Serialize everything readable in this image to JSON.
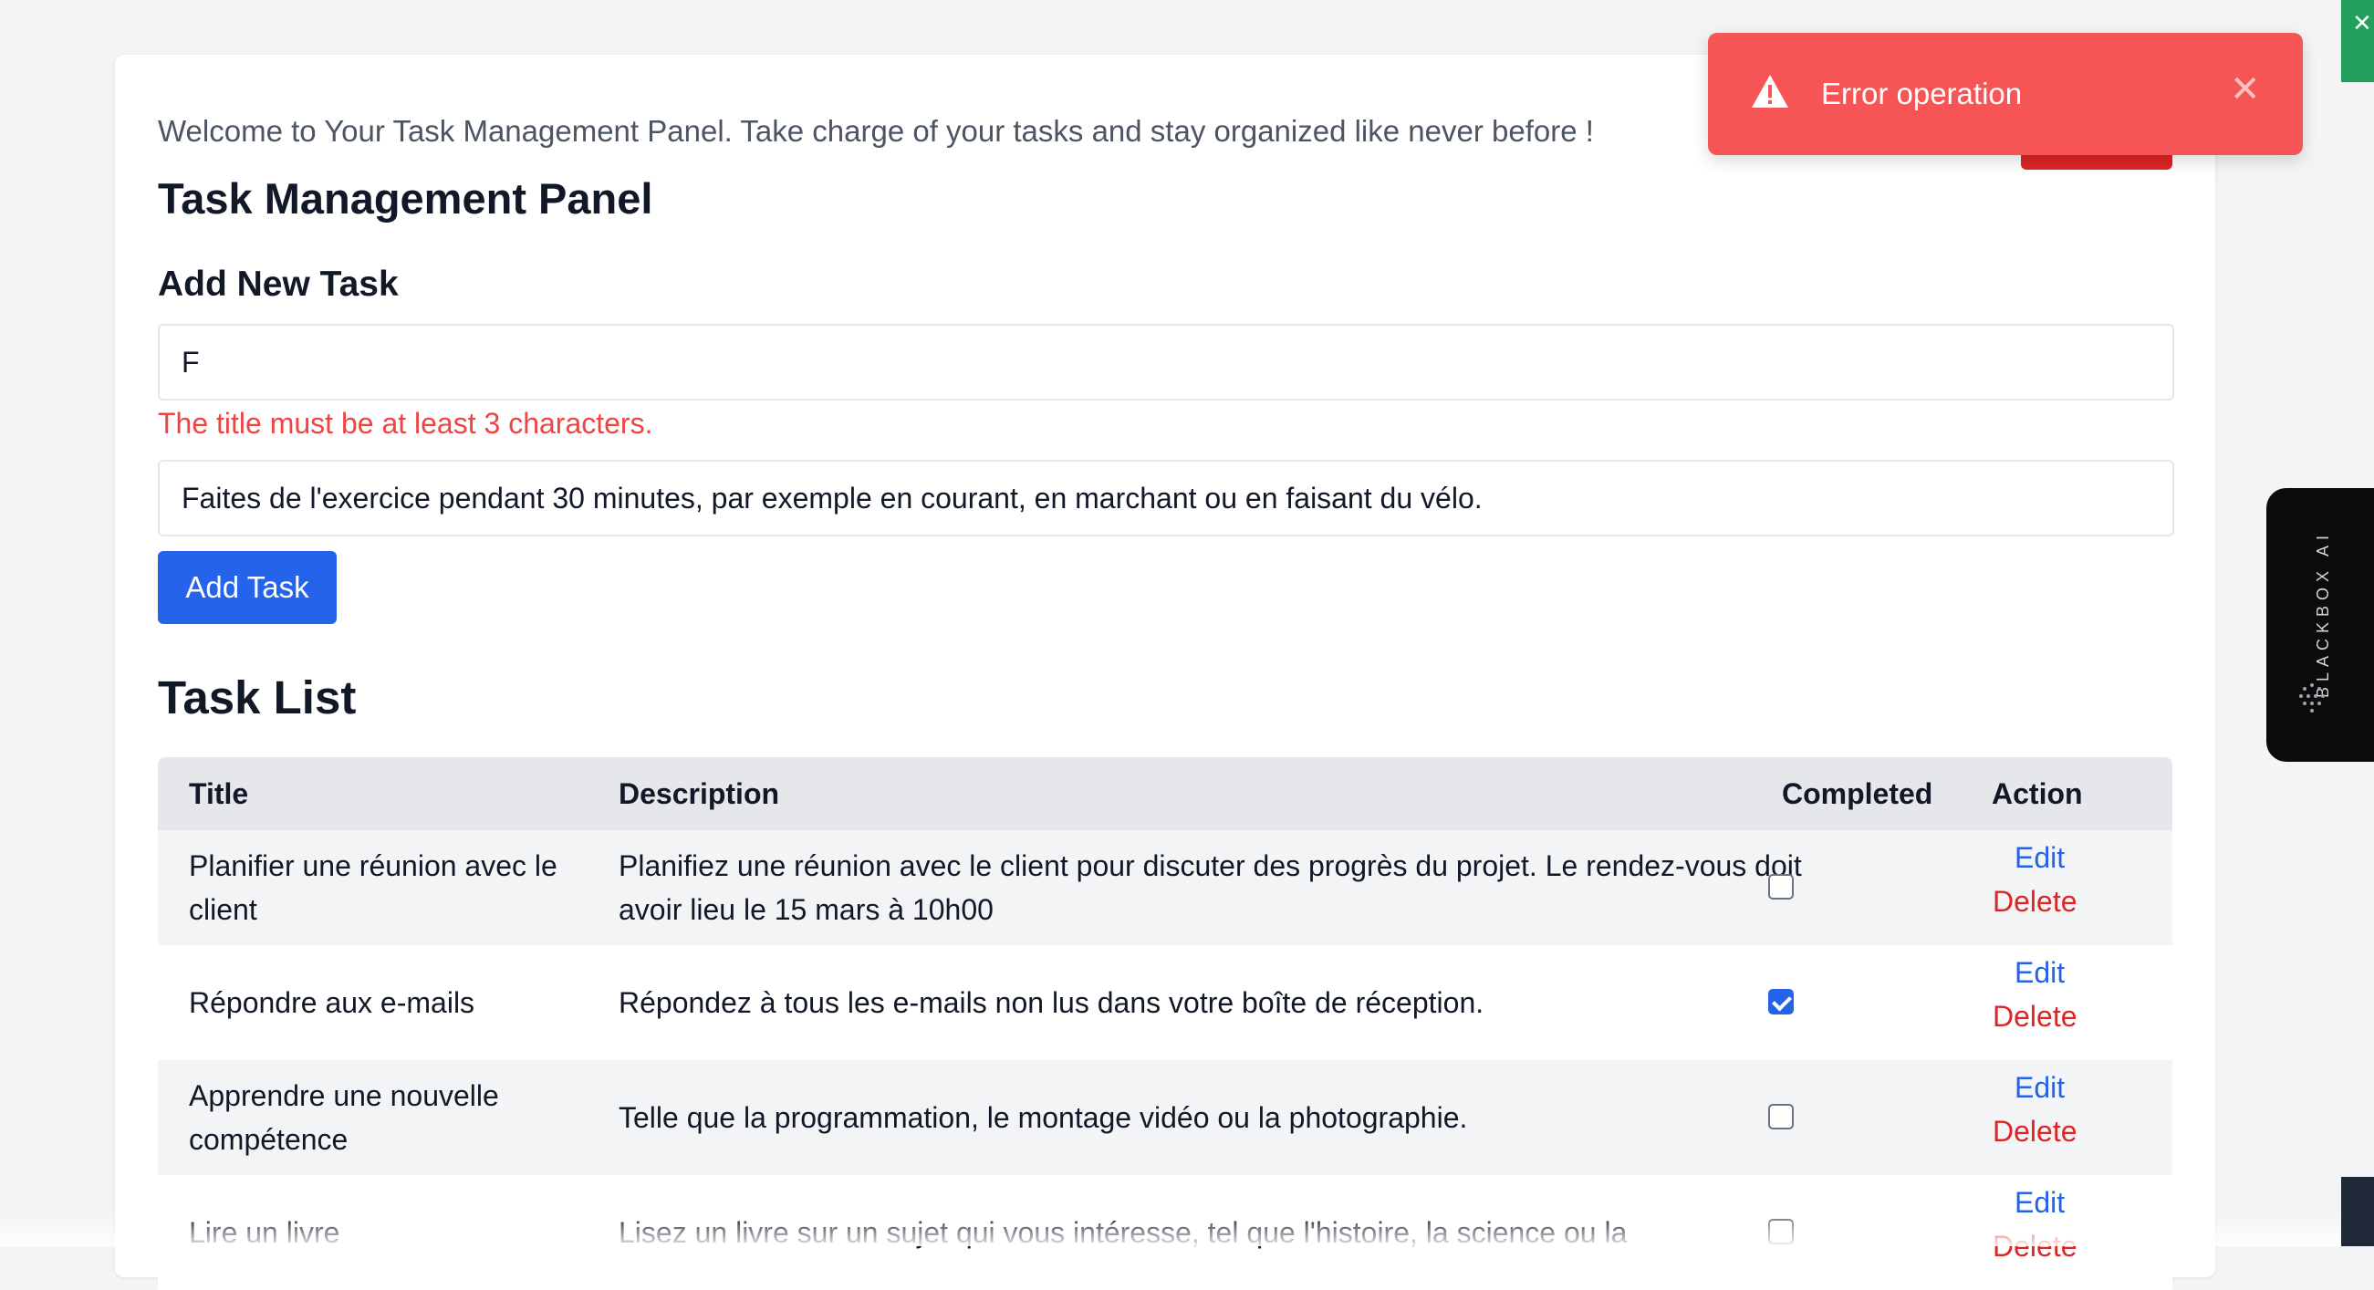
{
  "welcome_text": "Welcome to Your Task Management Panel. Take charge of your tasks and stay organized like never before !",
  "panel_title": "Task Management Panel",
  "add_task": {
    "heading": "Add New Task",
    "title_value": "F",
    "title_error": "The title must be at least 3 characters.",
    "description_value": "Faites de l'exercice pendant 30 minutes, par exemple en courant, en marchant ou en faisant du vélo.",
    "button_label": "Add Task"
  },
  "task_list": {
    "heading": "Task List",
    "columns": [
      "Title",
      "Description",
      "Completed",
      "Action"
    ],
    "rows": [
      {
        "title": "Planifier une réunion avec le client",
        "description": "Planifiez une réunion avec le client pour discuter des progrès du projet. Le rendez-vous doit avoir lieu le 15 mars à 10h00",
        "completed": false,
        "edit": "Edit",
        "delete": "Delete"
      },
      {
        "title": "Répondre aux e-mails",
        "description": "Répondez à tous les e-mails non lus dans votre boîte de réception.",
        "completed": true,
        "edit": "Edit",
        "delete": "Delete"
      },
      {
        "title": "Apprendre une nouvelle compétence",
        "description": "Telle que la programmation, le montage vidéo ou la photographie.",
        "completed": false,
        "edit": "Edit",
        "delete": "Delete"
      },
      {
        "title": "Lire un livre",
        "description": "Lisez un livre sur un sujet qui vous intéresse, tel que l'histoire, la science ou la",
        "completed": false,
        "edit": "Edit",
        "delete": "Delete"
      }
    ]
  },
  "toast": {
    "message": "Error operation",
    "icon": "warning-icon",
    "close_icon": "close-icon",
    "color": "#f75555"
  },
  "side_widget": {
    "label": "BLACKBOX AI",
    "icon": "dots-logo-icon"
  },
  "colors": {
    "primary": "#2563eb",
    "danger": "#dc2626",
    "error_text": "#ef4444"
  }
}
